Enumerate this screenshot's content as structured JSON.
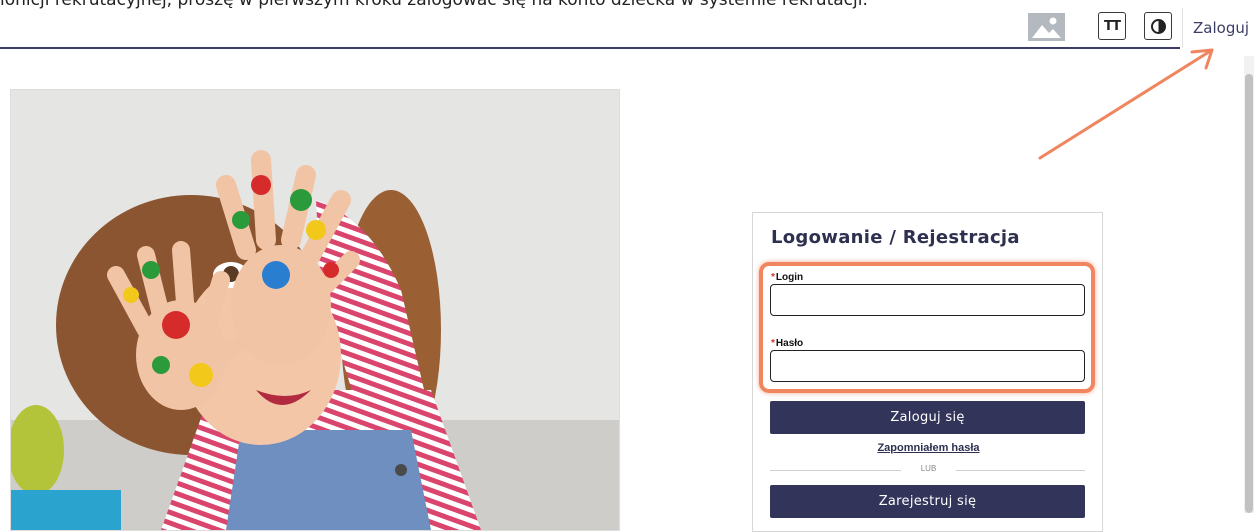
{
  "top_caption": "ionicji rekrutacyjnej, proszę w pierwszym kroku zalogować się na konto dziecka w systemie rekrutacji.",
  "header": {
    "image_toggle_icon": "image-icon",
    "font_size_icon": "text-size-icon",
    "font_size_label": "TT",
    "contrast_icon": "contrast-icon",
    "login_link": "Zaloguj"
  },
  "login_form": {
    "title": "Logowanie / Rejestracja",
    "required_mark": "*",
    "login_label": "Login",
    "login_value": "",
    "password_label": "Hasło",
    "password_value": "",
    "submit_label": "Zaloguj się",
    "forgot_password": "Zapomniałem hasła",
    "divider_text": "LUB",
    "register_label": "Zarejestruj się"
  },
  "annotation": {
    "color": "#f0855f"
  },
  "colors": {
    "primary": "#33345a",
    "header_line": "#3b3d66"
  }
}
